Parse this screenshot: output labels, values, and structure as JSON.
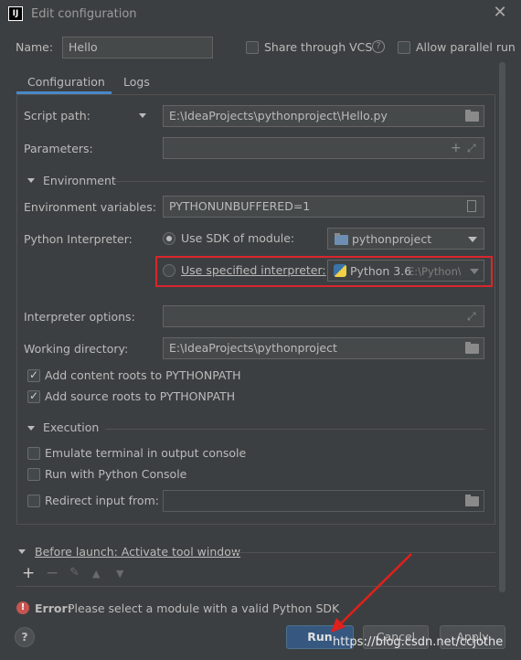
{
  "window": {
    "title": "Edit configuration",
    "app_icon_text": "IJ"
  },
  "header": {
    "name_label": "Name:",
    "name_value": "Hello",
    "share_vcs_label": "Share through VCS",
    "allow_parallel_label": "Allow parallel run"
  },
  "tabs": [
    {
      "label": "Configuration",
      "active": true
    },
    {
      "label": "Logs",
      "active": false
    }
  ],
  "config": {
    "script_path_label": "Script path:",
    "script_path_value": "E:\\IdeaProjects\\pythonproject\\Hello.py",
    "parameters_label": "Parameters:",
    "parameters_value": "",
    "environment_section": "Environment",
    "env_vars_label": "Environment variables:",
    "env_vars_value": "PYTHONUNBUFFERED=1",
    "interpreter_label": "Python Interpreter:",
    "use_sdk_label": "Use SDK of module:",
    "sdk_module_value": "pythonproject",
    "use_specified_label": "Use specified interpreter:",
    "specified_interpreter_name": "Python 3.6",
    "specified_interpreter_path": "E:\\Python\\P",
    "interpreter_options_label": "Interpreter options:",
    "interpreter_options_value": "",
    "working_dir_label": "Working directory:",
    "working_dir_value": "E:\\IdeaProjects\\pythonproject",
    "add_content_roots_label": "Add content roots to PYTHONPATH",
    "add_source_roots_label": "Add source roots to PYTHONPATH",
    "execution_section": "Execution",
    "emulate_terminal_label": "Emulate terminal in output console",
    "run_python_console_label": "Run with Python Console",
    "redirect_input_label": "Redirect input from:",
    "redirect_input_value": ""
  },
  "before_launch": {
    "label": "Before launch: Activate tool window"
  },
  "error": {
    "prefix": "Error:",
    "message": "Please select a module with a valid Python SDK"
  },
  "buttons": {
    "run": "Run",
    "cancel": "Cancel",
    "apply": "Apply",
    "help": "?"
  },
  "watermark": "https://blog.csdn.net/ccjothe",
  "colors": {
    "background": "#3c3f41",
    "accent": "#4a88c7",
    "highlight_box": "#d9262c",
    "error": "#c75450",
    "annotation_arrow": "#e0201b"
  }
}
